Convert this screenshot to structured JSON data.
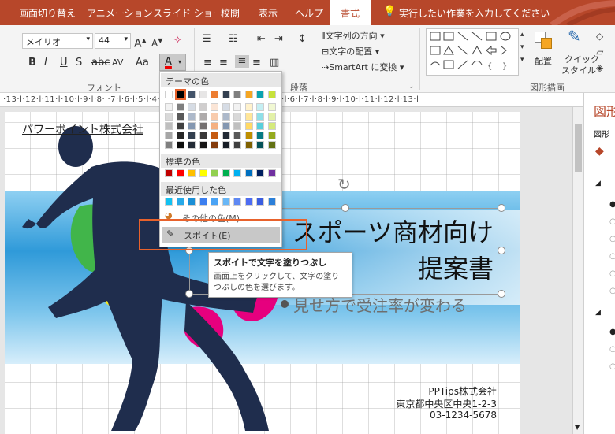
{
  "tabs": [
    "画面切り替え",
    "アニメーション",
    "スライド ショー",
    "校閲",
    "表示",
    "ヘルプ",
    "書式"
  ],
  "tell_me": "実行したい作業を入力してください",
  "font": {
    "name": "メイリオ",
    "size": "44",
    "bold": "B",
    "italic": "I",
    "underline": "U",
    "shadow": "S",
    "strike": "abc",
    "spacing": "AV",
    "case": "Aa",
    "color_letter": "A"
  },
  "groups": {
    "font": "フォント",
    "paragraph": "段落",
    "drawing": "図形描画"
  },
  "paragraph": {
    "text_direction": "文字列の方向",
    "align_text": "文字の配置",
    "smartart": "SmartArt に変換"
  },
  "drawing": {
    "arrange": "配置",
    "quick_styles_1": "クイック",
    "quick_styles_2": "スタイル"
  },
  "ruler_text": "·13·l·12·l·11·l·10·l·9·l·8·l·7·l·6·l·5·l·4·l·3·l·2·l·1·l·0·l·1·l·2·l·3·l·4·l·5·l·6·l·7·l·8·l·9·l·10·l·11·l·12·l·13·l",
  "dropdown": {
    "theme_colors": "テーマの色",
    "standard_colors": "標準の色",
    "recent_colors": "最近使用した色",
    "more_colors": "その他の色(M)...",
    "eyedropper": "スポイト(E)",
    "theme_top": [
      "#ffffff",
      "#000000",
      "#44546a",
      "#e7e6e6",
      "#ed7d31",
      "#333f50",
      "#7f7f7f",
      "#f5a623",
      "#0aa2b0",
      "#c7e23a"
    ],
    "theme_shades": [
      [
        "#f2f2f2",
        "#7f7f7f",
        "#d6dce4",
        "#d0cece",
        "#fbe5d6",
        "#d6dce5",
        "#f2f2f2",
        "#fff2cc",
        "#c5eff3",
        "#f1f8d3"
      ],
      [
        "#d9d9d9",
        "#595959",
        "#adb9ca",
        "#aeabab",
        "#f8cbad",
        "#adb9ca",
        "#d9d9d9",
        "#ffe699",
        "#8fdfe8",
        "#e3f1a8"
      ],
      [
        "#bfbfbf",
        "#404040",
        "#8497b0",
        "#757171",
        "#f4b183",
        "#8497b0",
        "#bfbfbf",
        "#ffd966",
        "#58cfdc",
        "#d5ea7d"
      ],
      [
        "#a6a6a6",
        "#262626",
        "#333f4f",
        "#3a3838",
        "#c55a11",
        "#222a35",
        "#595959",
        "#bf8f00",
        "#067a84",
        "#95ab1e"
      ],
      [
        "#7f7f7f",
        "#0d0d0d",
        "#222a35",
        "#171616",
        "#843c0c",
        "#161c24",
        "#3f3f3f",
        "#7f6000",
        "#045158",
        "#637214"
      ]
    ],
    "standard": [
      "#c00000",
      "#ff0000",
      "#ffc000",
      "#ffff00",
      "#92d050",
      "#00b050",
      "#00b0f0",
      "#0070c0",
      "#002060",
      "#7030a0"
    ],
    "recent": [
      "#12c1f1",
      "#27a9e8",
      "#1b8fd6",
      "#3c7ff0",
      "#4aa3f5",
      "#68b7f7",
      "#5e88f3",
      "#4d6cf2",
      "#3a5de0",
      "#2b7fd9"
    ]
  },
  "tooltip": {
    "title": "スポイトで文字を塗りつぶし",
    "body": "画面上をクリックして、文字の塗りつぶしの色を選びます。"
  },
  "slide": {
    "company_header": "パワーポイント株式会社",
    "title_line1": "スポーツ商材向け",
    "title_line2": "提案書",
    "subtitle": "見せ方で受注率が変わる",
    "footer_company": "PPTips株式会社",
    "footer_address": "東京都中央区中央1-2-3",
    "footer_phone": "03-1234-5678"
  },
  "right_pane": {
    "title": "図形",
    "sub": "図形"
  },
  "colors": {
    "accent": "#b7472a",
    "highlight_box": "#e8622c",
    "runner": "#1f2d4d",
    "magenta": "#e6007e",
    "yellow": "#f2e81e",
    "green": "#41b54a"
  }
}
